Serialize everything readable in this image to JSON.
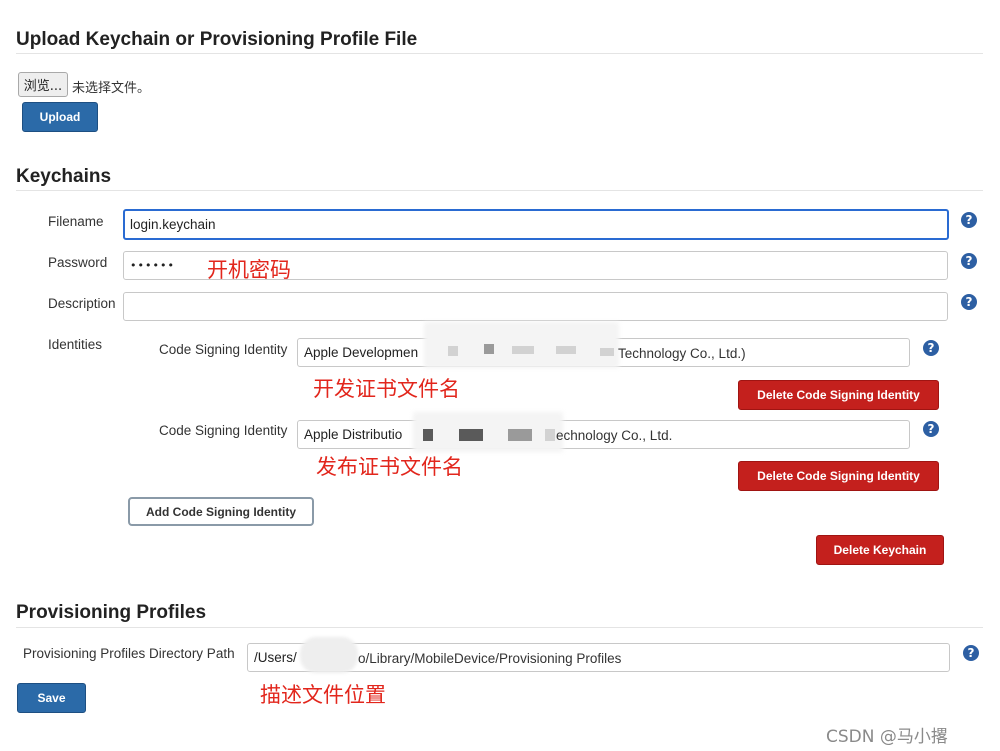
{
  "upload_section": {
    "title": "Upload Keychain or Provisioning Profile File",
    "browse_label": "浏览...",
    "no_file_text": "未选择文件。",
    "upload_label": "Upload"
  },
  "keychains_section": {
    "title": "Keychains",
    "filename_label": "Filename",
    "filename_value": "login.keychain",
    "password_label": "Password",
    "password_value": "••••••",
    "password_annotation": "开机密码",
    "description_label": "Description",
    "description_value": "",
    "identities_label": "Identities",
    "identities": [
      {
        "label": "Code Signing Identity",
        "value_prefix": "Apple Developmen",
        "value_suffix": "Technology Co., Ltd.)",
        "annotation": "开发证书文件名",
        "delete_label": "Delete Code Signing Identity"
      },
      {
        "label": "Code Signing Identity",
        "value_prefix": "Apple Distributio",
        "value_suffix": "echnology Co., Ltd.",
        "annotation": "发布证书文件名",
        "delete_label": "Delete Code Signing Identity"
      }
    ],
    "add_identity_label": "Add Code Signing Identity",
    "delete_keychain_label": "Delete Keychain"
  },
  "provisioning_section": {
    "title": "Provisioning Profiles",
    "path_label": "Provisioning Profiles Directory Path",
    "path_prefix": "/Users/",
    "path_suffix": "o/Library/MobileDevice/Provisioning Profiles",
    "path_annotation": "描述文件位置",
    "save_label": "Save"
  },
  "help_glyph": "?",
  "watermark": "CSDN @马小撂",
  "colors": {
    "primary": "#2b6aa8",
    "danger": "#c4201d",
    "help": "#2d5fa3",
    "annotation": "#e2261c",
    "focus": "#2a6bd2"
  }
}
